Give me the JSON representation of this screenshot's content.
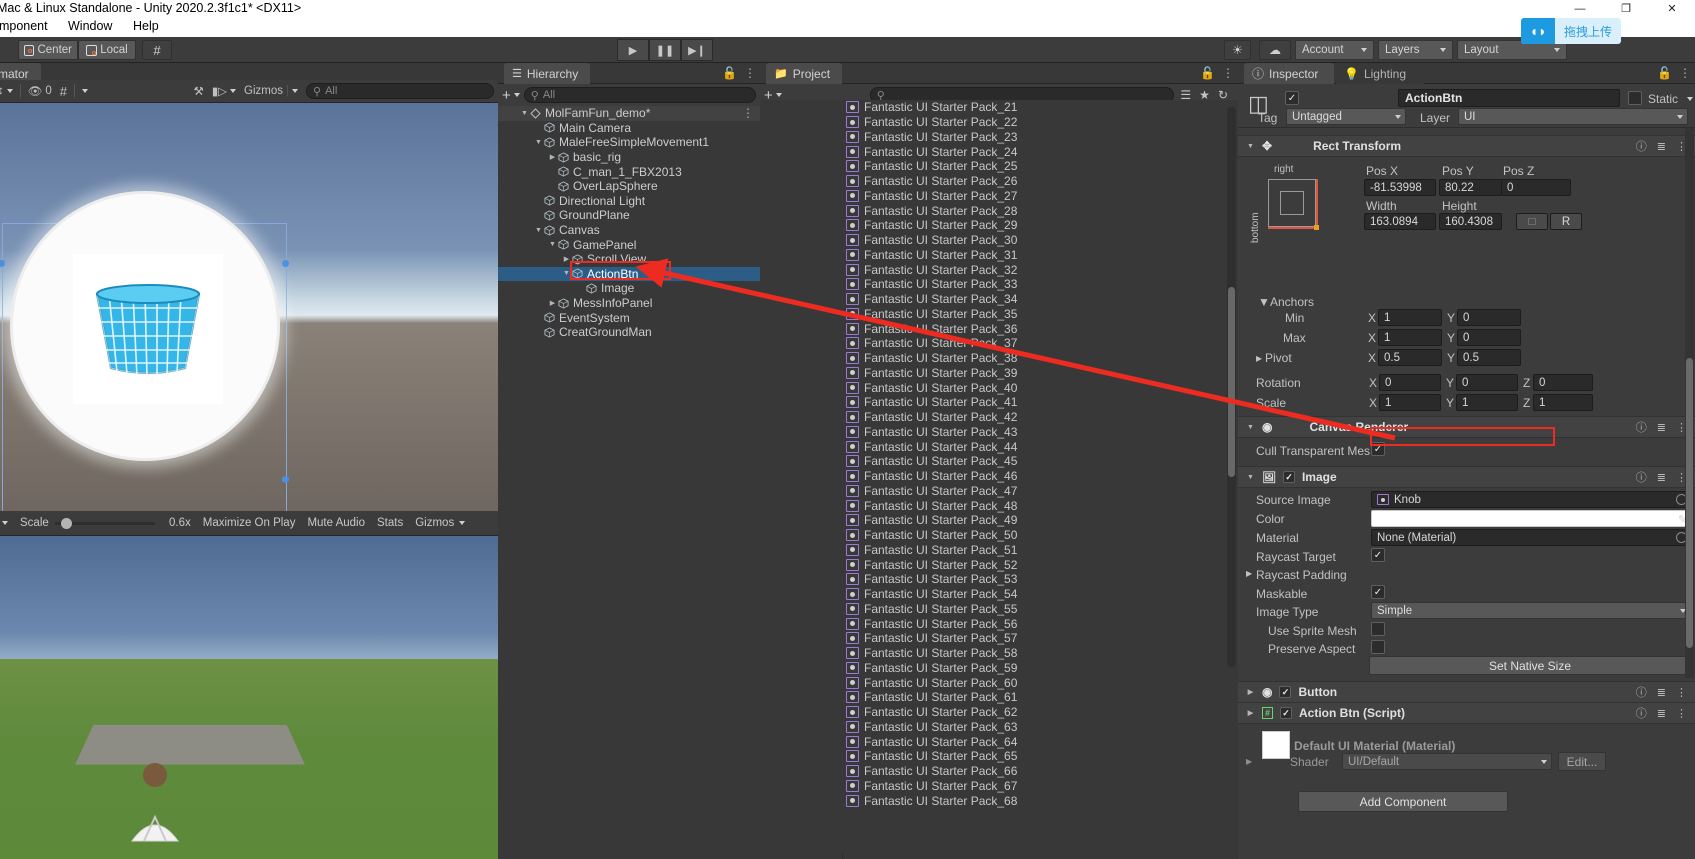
{
  "window": {
    "title": "Mac & Linux Standalone - Unity 2020.2.3f1c1* <DX11>",
    "minimize": "—",
    "maximize": "❐",
    "close": "✕"
  },
  "menubar": {
    "items": [
      "omponent",
      "Window",
      "Help"
    ]
  },
  "toolbar": {
    "center_label": "Center",
    "local_label": "Local",
    "grid_icon": "grid-snap-icon",
    "play": "▶",
    "pause": "❚❚",
    "step": "▶❙",
    "light_icon": "sun-icon",
    "cloud_icon": "cloud-icon",
    "account": "Account",
    "layers": "Layers",
    "layout": "Layout",
    "upload_badge": "拖拽上传"
  },
  "scene": {
    "tab_label": "mator",
    "gizmos": "Gizmos",
    "search_placeholder": "All",
    "hidden_count": "0",
    "accent": "#4a90e2"
  },
  "game": {
    "scale_label": "Scale",
    "scale_value": "0.6x",
    "maximize": "Maximize On Play",
    "mute": "Mute Audio",
    "stats": "Stats",
    "gizmos": "Gizmos"
  },
  "hierarchy": {
    "tab_label": "Hierarchy",
    "search_placeholder": "All",
    "add_label": "+",
    "items": [
      {
        "label": "MolFamFun_demo*",
        "depth": 0,
        "arrow": "down",
        "icon": "scene-icon",
        "selected": false,
        "header": true
      },
      {
        "label": "Main Camera",
        "depth": 1,
        "arrow": "none",
        "icon": "gameobject-icon",
        "selected": false
      },
      {
        "label": "MaleFreeSimpleMovement1",
        "depth": 1,
        "arrow": "down",
        "icon": "gameobject-icon",
        "selected": false
      },
      {
        "label": "basic_rig",
        "depth": 2,
        "arrow": "right",
        "icon": "gameobject-icon",
        "selected": false
      },
      {
        "label": "C_man_1_FBX2013",
        "depth": 2,
        "arrow": "none",
        "icon": "gameobject-icon",
        "selected": false
      },
      {
        "label": "OverLapSphere",
        "depth": 2,
        "arrow": "none",
        "icon": "gameobject-icon",
        "selected": false
      },
      {
        "label": "Directional Light",
        "depth": 1,
        "arrow": "none",
        "icon": "gameobject-icon",
        "selected": false
      },
      {
        "label": "GroundPlane",
        "depth": 1,
        "arrow": "none",
        "icon": "gameobject-icon",
        "selected": false
      },
      {
        "label": "Canvas",
        "depth": 1,
        "arrow": "down",
        "icon": "gameobject-icon",
        "selected": false
      },
      {
        "label": "GamePanel",
        "depth": 2,
        "arrow": "down",
        "icon": "gameobject-icon",
        "selected": false
      },
      {
        "label": "Scroll View",
        "depth": 3,
        "arrow": "right",
        "icon": "gameobject-icon",
        "selected": false
      },
      {
        "label": "ActionBtn",
        "depth": 3,
        "arrow": "down",
        "icon": "gameobject-icon",
        "selected": true
      },
      {
        "label": "Image",
        "depth": 4,
        "arrow": "none",
        "icon": "gameobject-icon",
        "selected": false
      },
      {
        "label": "MessInfoPanel",
        "depth": 2,
        "arrow": "right",
        "icon": "gameobject-icon",
        "selected": false
      },
      {
        "label": "EventSystem",
        "depth": 1,
        "arrow": "none",
        "icon": "gameobject-icon",
        "selected": false
      },
      {
        "label": "CreatGroundMan",
        "depth": 1,
        "arrow": "none",
        "icon": "gameobject-icon",
        "selected": false
      }
    ]
  },
  "project": {
    "tab_label": "Project",
    "add_label": "+",
    "search_placeholder": "",
    "assets": [
      "Fantastic UI Starter Pack_21",
      "Fantastic UI Starter Pack_22",
      "Fantastic UI Starter Pack_23",
      "Fantastic UI Starter Pack_24",
      "Fantastic UI Starter Pack_25",
      "Fantastic UI Starter Pack_26",
      "Fantastic UI Starter Pack_27",
      "Fantastic UI Starter Pack_28",
      "Fantastic UI Starter Pack_29",
      "Fantastic UI Starter Pack_30",
      "Fantastic UI Starter Pack_31",
      "Fantastic UI Starter Pack_32",
      "Fantastic UI Starter Pack_33",
      "Fantastic UI Starter Pack_34",
      "Fantastic UI Starter Pack_35",
      "Fantastic UI Starter Pack_36",
      "Fantastic UI Starter Pack_37",
      "Fantastic UI Starter Pack_38",
      "Fantastic UI Starter Pack_39",
      "Fantastic UI Starter Pack_40",
      "Fantastic UI Starter Pack_41",
      "Fantastic UI Starter Pack_42",
      "Fantastic UI Starter Pack_43",
      "Fantastic UI Starter Pack_44",
      "Fantastic UI Starter Pack_45",
      "Fantastic UI Starter Pack_46",
      "Fantastic UI Starter Pack_47",
      "Fantastic UI Starter Pack_48",
      "Fantastic UI Starter Pack_49",
      "Fantastic UI Starter Pack_50",
      "Fantastic UI Starter Pack_51",
      "Fantastic UI Starter Pack_52",
      "Fantastic UI Starter Pack_53",
      "Fantastic UI Starter Pack_54",
      "Fantastic UI Starter Pack_55",
      "Fantastic UI Starter Pack_56",
      "Fantastic UI Starter Pack_57",
      "Fantastic UI Starter Pack_58",
      "Fantastic UI Starter Pack_59",
      "Fantastic UI Starter Pack_60",
      "Fantastic UI Starter Pack_61",
      "Fantastic UI Starter Pack_62",
      "Fantastic UI Starter Pack_63",
      "Fantastic UI Starter Pack_64",
      "Fantastic UI Starter Pack_65",
      "Fantastic UI Starter Pack_66",
      "Fantastic UI Starter Pack_67",
      "Fantastic UI Starter Pack_68"
    ]
  },
  "inspector": {
    "tab_label": "Inspector",
    "lighting_tab_label": "Lighting",
    "object_name": "ActionBtn",
    "static_label": "Static",
    "tag_label": "Tag",
    "tag_value": "Untagged",
    "layer_label": "Layer",
    "layer_value": "UI",
    "rect_transform": {
      "title": "Rect Transform",
      "anchor_preset_right": "right",
      "anchor_preset_bottom": "bottom",
      "pos_x_label": "Pos X",
      "pos_x": "-81.53998",
      "pos_y_label": "Pos Y",
      "pos_y": "80.22",
      "pos_z_label": "Pos Z",
      "pos_z": "0",
      "width_label": "Width",
      "width": "163.0894",
      "height_label": "Height",
      "height": "160.4308",
      "blueprint_label": "",
      "raw_label": "R",
      "anchors_label": "Anchors",
      "min_label": "Min",
      "min_x": "1",
      "min_y": "0",
      "max_label": "Max",
      "max_x": "1",
      "max_y": "0",
      "pivot_label": "Pivot",
      "pivot_x": "0.5",
      "pivot_y": "0.5",
      "rotation_label": "Rotation",
      "rot_x": "0",
      "rot_y": "0",
      "rot_z": "0",
      "scale_label": "Scale",
      "scale_x": "1",
      "scale_y": "1",
      "scale_z": "1",
      "axis_x": "X",
      "axis_y": "Y",
      "axis_z": "Z"
    },
    "canvas_renderer": {
      "title": "Canvas Renderer",
      "cull_label": "Cull Transparent Mes"
    },
    "image": {
      "title": "Image",
      "source_image_label": "Source Image",
      "source_image_value": "Knob",
      "color_label": "Color",
      "color_value": "#FFFFFF",
      "material_label": "Material",
      "material_value": "None (Material)",
      "raycast_target_label": "Raycast Target",
      "raycast_padding_label": "Raycast Padding",
      "maskable_label": "Maskable",
      "image_type_label": "Image Type",
      "image_type_value": "Simple",
      "use_sprite_mesh_label": "Use Sprite Mesh",
      "preserve_aspect_label": "Preserve Aspect",
      "set_native_size_label": "Set Native Size"
    },
    "button": {
      "title": "Button"
    },
    "script": {
      "title": "Action Btn (Script)"
    },
    "material": {
      "title": "Default UI Material (Material)",
      "shader_label": "Shader",
      "shader_value": "UI/Default",
      "edit_label": "Edit..."
    },
    "add_component_label": "Add Component"
  },
  "annotation": {
    "color": "#ee2b20"
  }
}
